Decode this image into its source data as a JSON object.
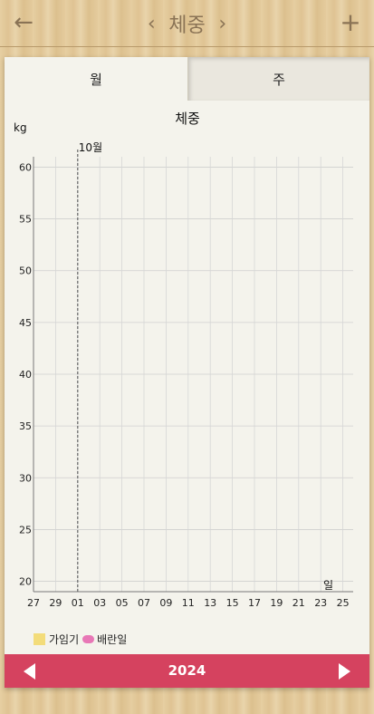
{
  "header": {
    "title": "체중",
    "back_icon": "arrow-left-icon",
    "add_icon": "plus-icon",
    "prev_icon": "chevron-left-icon",
    "next_icon": "chevron-right-icon"
  },
  "tabs": [
    {
      "label": "월",
      "selected": true
    },
    {
      "label": "주",
      "selected": false
    }
  ],
  "chart_data": {
    "type": "line",
    "title": "체중",
    "ylabel": "kg",
    "xlabel": "일",
    "ylim": [
      19,
      61
    ],
    "yticks": [
      60,
      55,
      50,
      45,
      40,
      35,
      30,
      25,
      20
    ],
    "x": [
      "27",
      "29",
      "01",
      "03",
      "05",
      "07",
      "09",
      "11",
      "13",
      "15",
      "17",
      "19",
      "21",
      "23",
      "25"
    ],
    "month_marker": {
      "label": "10월",
      "at": "01"
    },
    "series": [],
    "grid": true
  },
  "legend": [
    {
      "label": "가임기",
      "color": "#f3dc7a"
    },
    {
      "label": "배란일",
      "color": "#e877b6"
    }
  ],
  "footer": {
    "year": "2024",
    "prev_icon": "triangle-left-icon",
    "next_icon": "triangle-right-icon"
  }
}
